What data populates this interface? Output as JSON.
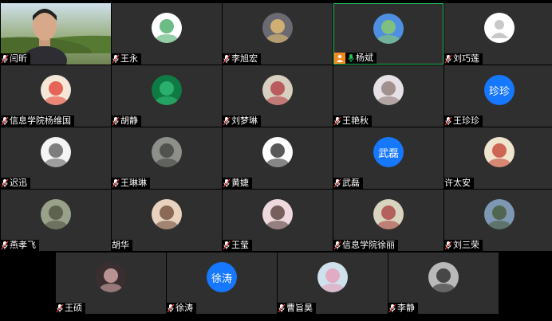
{
  "participants": [
    {
      "name": "闫昕",
      "kind": "video",
      "mic": "muted"
    },
    {
      "name": "王永",
      "kind": "image",
      "bg": "#ffffff",
      "fg": "#3aa65c",
      "mic": "muted"
    },
    {
      "name": "李旭宏",
      "kind": "image",
      "bg": "#6b6a72",
      "fg": "#f1c774",
      "mic": "muted"
    },
    {
      "name": "杨斌",
      "kind": "image",
      "bg": "#4f8fe2",
      "fg": "#8fd05f",
      "mic": "active",
      "host": true,
      "speaking": true
    },
    {
      "name": "刘巧莲",
      "kind": "default",
      "bg": "#ffffff",
      "fg": "#c8c8c8",
      "mic": "muted"
    },
    {
      "name": "信息学院杨维国",
      "kind": "image",
      "bg": "#f5e7d8",
      "fg": "#e0382c",
      "mic": "muted"
    },
    {
      "name": "胡静",
      "kind": "image",
      "bg": "#0e7a44",
      "fg": "#34c27a",
      "mic": "muted"
    },
    {
      "name": "刘梦琳",
      "kind": "image",
      "bg": "#d7cfc0",
      "fg": "#b0343e",
      "mic": "muted"
    },
    {
      "name": "王艳秋",
      "kind": "image",
      "bg": "#e6e1e6",
      "fg": "#8a7470",
      "mic": "muted"
    },
    {
      "name": "王珍珍",
      "kind": "text",
      "initials": "珍珍",
      "mic": "muted"
    },
    {
      "name": "迟迅",
      "kind": "image",
      "bg": "#f4f4f4",
      "fg": "#555555",
      "mic": "muted"
    },
    {
      "name": "王琳琳",
      "kind": "image",
      "bg": "#8c8f8a",
      "fg": "#3d3f3b",
      "mic": "muted"
    },
    {
      "name": "黄婕",
      "kind": "image",
      "bg": "#ffffff",
      "fg": "#222222",
      "mic": "muted"
    },
    {
      "name": "武磊",
      "kind": "text",
      "initials": "武磊",
      "mic": "muted"
    },
    {
      "name": "许太安",
      "kind": "image",
      "bg": "#efe5cf",
      "fg": "#c23b2a",
      "mic": "none"
    },
    {
      "name": "燕孝飞",
      "kind": "image",
      "bg": "#9aa18a",
      "fg": "#4a4f3c",
      "mic": "muted"
    },
    {
      "name": "胡华",
      "kind": "image",
      "bg": "#e9d2c0",
      "fg": "#6a4533",
      "mic": "none"
    },
    {
      "name": "王莹",
      "kind": "image",
      "bg": "#efd9df",
      "fg": "#4d3630",
      "mic": "muted"
    },
    {
      "name": "信息学院徐丽",
      "kind": "image",
      "bg": "#d8d4bf",
      "fg": "#a53b3b",
      "mic": "muted"
    },
    {
      "name": "刘三荣",
      "kind": "image",
      "bg": "#7e97b3",
      "fg": "#42552f",
      "mic": "muted"
    },
    {
      "name": "王硕",
      "kind": "image",
      "bg": "#3b2e31",
      "fg": "#e4b6b3",
      "mic": "muted"
    },
    {
      "name": "徐涛",
      "kind": "text",
      "initials": "徐涛",
      "mic": "muted"
    },
    {
      "name": "曹旨昊",
      "kind": "image",
      "bg": "#cfe1ec",
      "fg": "#e79ab5",
      "mic": "muted"
    },
    {
      "name": "李静",
      "kind": "image",
      "bg": "#b9b9b9",
      "fg": "#222222",
      "mic": "muted"
    }
  ]
}
